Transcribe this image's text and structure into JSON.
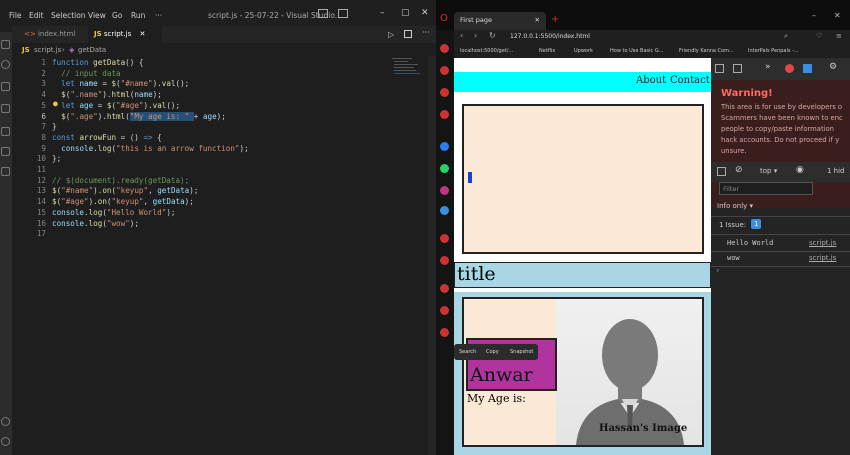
{
  "vscode": {
    "menu": [
      "File",
      "Edit",
      "Selection",
      "View",
      "Go",
      "Run",
      "···"
    ],
    "window_title": "script.js - 25-07-22 - Visual Studio...",
    "tabs": [
      "index.html",
      "script.js"
    ],
    "breadcrumb": {
      "file": "script.js",
      "symbol": "getData"
    },
    "lines": [
      "1",
      "2",
      "3",
      "4",
      "5",
      "6",
      "7",
      "8",
      "9",
      "10",
      "11",
      "12",
      "13",
      "14",
      "15",
      "16",
      "17"
    ]
  },
  "browser": {
    "tab_title": "First page",
    "address": "127.0.0.1:5500/index.html",
    "bookmarks": [
      "localhost:5000/get/...",
      "Netflix",
      "Upwork",
      "How to Use Basic G...",
      "Friendly Kanna Com...",
      "InterPals Penpals -..."
    ]
  },
  "page": {
    "nav": [
      "About",
      "Contact"
    ],
    "title": "title",
    "name": "Anwar",
    "age_label": "My Age is:",
    "image_caption": "Hassan's Image",
    "popup": [
      "Search",
      "Copy",
      "Snapshot"
    ]
  },
  "devtools": {
    "warning_title": "Warning!",
    "warning_lines": [
      "This area is for use by developers o",
      "Scammers have been known to enc",
      "people to copy/paste information",
      "hack accounts. Do not proceed if y",
      "unsure."
    ],
    "context": "top ▾",
    "hidden": "1 hid",
    "filter_placeholder": "Filter",
    "levels": "Info only ▾",
    "issues_label": "1 Issue:",
    "issues_count": "1",
    "logs": [
      {
        "msg": "Hello World",
        "src": "script.js"
      },
      {
        "msg": "wow",
        "src": "script.js"
      }
    ],
    "prompt": "›"
  },
  "colors": {
    "accent": "#569cd6",
    "cyan_nav": "#00ffff",
    "title_bg": "#a9d6e5",
    "card_bg": "#fbe9d6",
    "name_bg": "#b0339e",
    "warning_bg": "#3a1d1d"
  }
}
